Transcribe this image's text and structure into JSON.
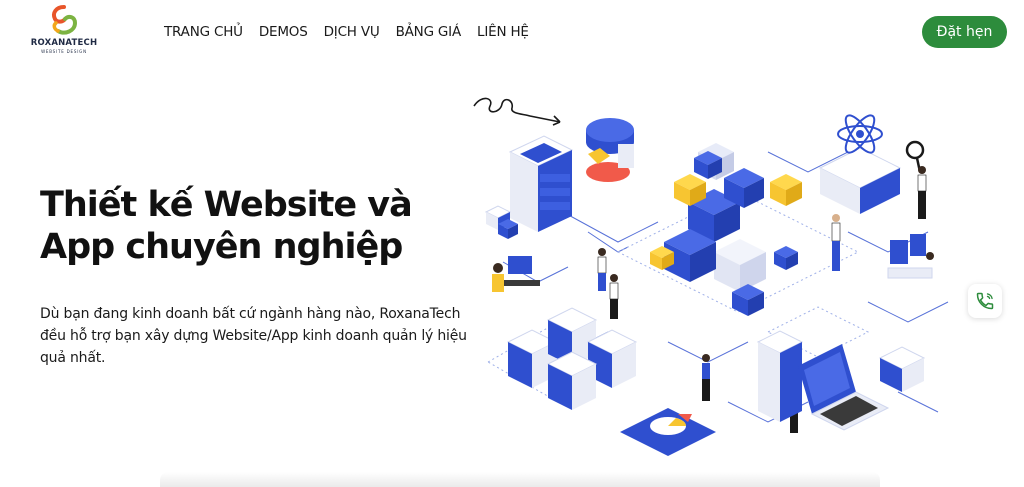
{
  "logo": {
    "name": "ROXANATECH",
    "tagline": "WEBSITE DESIGN"
  },
  "nav": {
    "items": [
      {
        "label": "TRANG CHỦ"
      },
      {
        "label": "DEMOS"
      },
      {
        "label": "DỊCH VỤ"
      },
      {
        "label": "BẢNG GIÁ"
      },
      {
        "label": "LIÊN HỆ"
      }
    ]
  },
  "header": {
    "cta_label": "Đặt hẹn"
  },
  "hero": {
    "title_line1": "Thiết kế Website và",
    "title_line2": "App chuyên nghiệp",
    "description": "Dù bạn đang kinh doanh bất cứ ngành hàng nào, RoxanaTech đều hỗ trợ bạn xây dựng Website/App kinh doanh quản lý hiệu quả nhất."
  },
  "widgets": {
    "phone_icon": "phone-icon"
  },
  "colors": {
    "accent_green": "#2d8c3c",
    "illustration_blue": "#2f4fcf",
    "illustration_yellow": "#f7c531",
    "illustration_red": "#f15a4a"
  }
}
